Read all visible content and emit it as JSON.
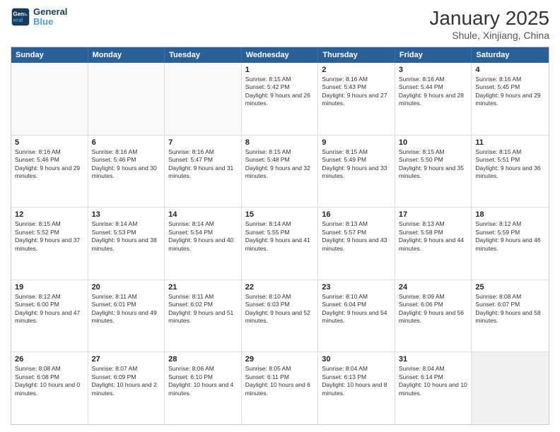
{
  "logo": {
    "line1": "General",
    "line2": "Blue"
  },
  "title": "January 2025",
  "subtitle": "Shule, Xinjiang, China",
  "weekdays": [
    "Sunday",
    "Monday",
    "Tuesday",
    "Wednesday",
    "Thursday",
    "Friday",
    "Saturday"
  ],
  "rows": [
    [
      {
        "day": "",
        "text": "",
        "empty": true
      },
      {
        "day": "",
        "text": "",
        "empty": true
      },
      {
        "day": "",
        "text": "",
        "empty": true
      },
      {
        "day": "1",
        "text": "Sunrise: 8:15 AM\nSunset: 5:42 PM\nDaylight: 9 hours and 26 minutes."
      },
      {
        "day": "2",
        "text": "Sunrise: 8:16 AM\nSunset: 5:43 PM\nDaylight: 9 hours and 27 minutes."
      },
      {
        "day": "3",
        "text": "Sunrise: 8:16 AM\nSunset: 5:44 PM\nDaylight: 9 hours and 28 minutes."
      },
      {
        "day": "4",
        "text": "Sunrise: 8:16 AM\nSunset: 5:45 PM\nDaylight: 9 hours and 29 minutes."
      }
    ],
    [
      {
        "day": "5",
        "text": "Sunrise: 8:16 AM\nSunset: 5:46 PM\nDaylight: 9 hours and 29 minutes."
      },
      {
        "day": "6",
        "text": "Sunrise: 8:16 AM\nSunset: 5:46 PM\nDaylight: 9 hours and 30 minutes."
      },
      {
        "day": "7",
        "text": "Sunrise: 8:16 AM\nSunset: 5:47 PM\nDaylight: 9 hours and 31 minutes."
      },
      {
        "day": "8",
        "text": "Sunrise: 8:15 AM\nSunset: 5:48 PM\nDaylight: 9 hours and 32 minutes."
      },
      {
        "day": "9",
        "text": "Sunrise: 8:15 AM\nSunset: 5:49 PM\nDaylight: 9 hours and 33 minutes."
      },
      {
        "day": "10",
        "text": "Sunrise: 8:15 AM\nSunset: 5:50 PM\nDaylight: 9 hours and 35 minutes."
      },
      {
        "day": "11",
        "text": "Sunrise: 8:15 AM\nSunset: 5:51 PM\nDaylight: 9 hours and 36 minutes."
      }
    ],
    [
      {
        "day": "12",
        "text": "Sunrise: 8:15 AM\nSunset: 5:52 PM\nDaylight: 9 hours and 37 minutes."
      },
      {
        "day": "13",
        "text": "Sunrise: 8:14 AM\nSunset: 5:53 PM\nDaylight: 9 hours and 38 minutes."
      },
      {
        "day": "14",
        "text": "Sunrise: 8:14 AM\nSunset: 5:54 PM\nDaylight: 9 hours and 40 minutes."
      },
      {
        "day": "15",
        "text": "Sunrise: 8:14 AM\nSunset: 5:55 PM\nDaylight: 9 hours and 41 minutes."
      },
      {
        "day": "16",
        "text": "Sunrise: 8:13 AM\nSunset: 5:57 PM\nDaylight: 9 hours and 43 minutes."
      },
      {
        "day": "17",
        "text": "Sunrise: 8:13 AM\nSunset: 5:58 PM\nDaylight: 9 hours and 44 minutes."
      },
      {
        "day": "18",
        "text": "Sunrise: 8:12 AM\nSunset: 5:59 PM\nDaylight: 9 hours and 46 minutes."
      }
    ],
    [
      {
        "day": "19",
        "text": "Sunrise: 8:12 AM\nSunset: 6:00 PM\nDaylight: 9 hours and 47 minutes."
      },
      {
        "day": "20",
        "text": "Sunrise: 8:11 AM\nSunset: 6:01 PM\nDaylight: 9 hours and 49 minutes."
      },
      {
        "day": "21",
        "text": "Sunrise: 8:11 AM\nSunset: 6:02 PM\nDaylight: 9 hours and 51 minutes."
      },
      {
        "day": "22",
        "text": "Sunrise: 8:10 AM\nSunset: 6:03 PM\nDaylight: 9 hours and 52 minutes."
      },
      {
        "day": "23",
        "text": "Sunrise: 8:10 AM\nSunset: 6:04 PM\nDaylight: 9 hours and 54 minutes."
      },
      {
        "day": "24",
        "text": "Sunrise: 8:09 AM\nSunset: 6:06 PM\nDaylight: 9 hours and 56 minutes."
      },
      {
        "day": "25",
        "text": "Sunrise: 8:08 AM\nSunset: 6:07 PM\nDaylight: 9 hours and 58 minutes."
      }
    ],
    [
      {
        "day": "26",
        "text": "Sunrise: 8:08 AM\nSunset: 6:08 PM\nDaylight: 10 hours and 0 minutes."
      },
      {
        "day": "27",
        "text": "Sunrise: 8:07 AM\nSunset: 6:09 PM\nDaylight: 10 hours and 2 minutes."
      },
      {
        "day": "28",
        "text": "Sunrise: 8:06 AM\nSunset: 6:10 PM\nDaylight: 10 hours and 4 minutes."
      },
      {
        "day": "29",
        "text": "Sunrise: 8:05 AM\nSunset: 6:11 PM\nDaylight: 10 hours and 6 minutes."
      },
      {
        "day": "30",
        "text": "Sunrise: 8:04 AM\nSunset: 6:13 PM\nDaylight: 10 hours and 8 minutes."
      },
      {
        "day": "31",
        "text": "Sunrise: 8:04 AM\nSunset: 6:14 PM\nDaylight: 10 hours and 10 minutes."
      },
      {
        "day": "",
        "text": "",
        "empty": true,
        "shaded": true
      }
    ]
  ]
}
